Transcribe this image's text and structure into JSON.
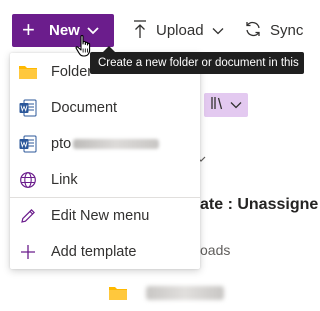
{
  "toolbar": {
    "new_label": "New",
    "upload_label": "Upload",
    "sync_label": "Sync"
  },
  "tooltip": {
    "text": "Create a new folder or document in this"
  },
  "menu": {
    "items": [
      {
        "label": "Folder",
        "icon": "folder-icon"
      },
      {
        "label": "Document",
        "icon": "word-icon"
      },
      {
        "label": "pto",
        "icon": "word-icon"
      },
      {
        "label": "Link",
        "icon": "globe-icon"
      },
      {
        "label": "Edit New menu",
        "icon": "pencil-icon"
      },
      {
        "label": "Add template",
        "icon": "plus-icon"
      }
    ]
  },
  "background": {
    "title": "ate : Unassigne",
    "subtitle": "oads"
  },
  "colors": {
    "accent": "#6b1d8c",
    "tooltip_bg": "#1f1f1f",
    "folder": "#ffb900",
    "word": "#2b579a",
    "view_button_bg": "#e3c9f0"
  }
}
